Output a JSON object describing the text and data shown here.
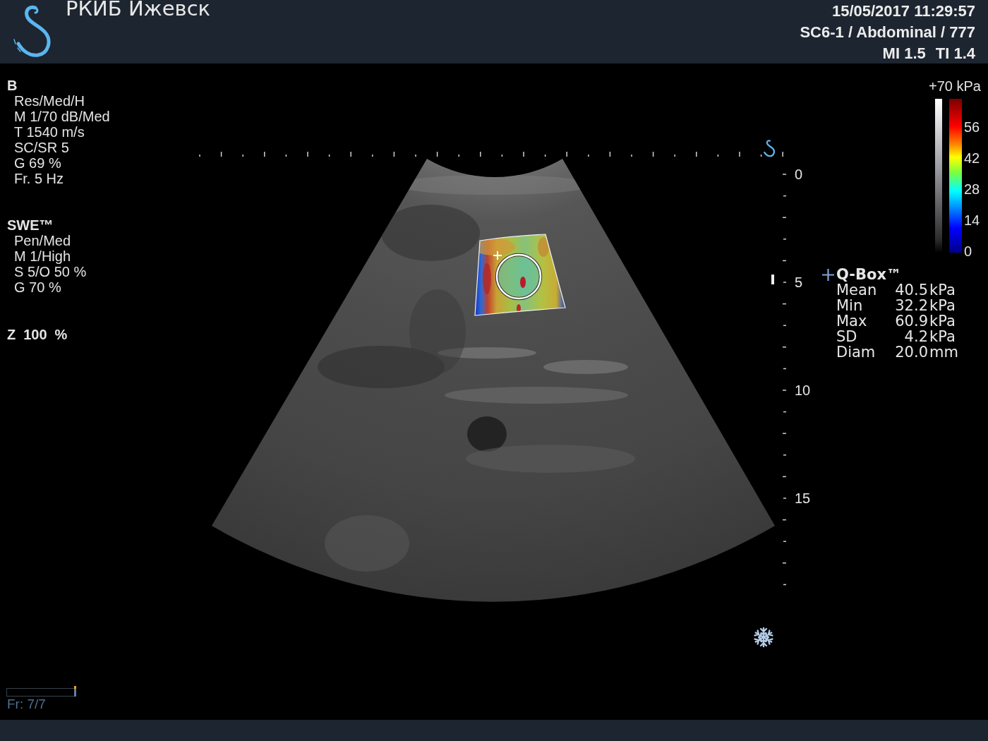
{
  "header": {
    "title": "РКИБ Ижевск",
    "datetime": "15/05/2017 11:29:57",
    "preset": "SC6-1 / Abdominal / 777",
    "indices": [
      "MI 1.5",
      "TI 1.4"
    ]
  },
  "parameters": [
    {
      "heading": "B",
      "lines": [
        "Res/Med/H",
        "M 1/70 dB/Med",
        "T 1540 m/s",
        "SC/SR 5",
        "G 69 %",
        "Fr. 5 Hz"
      ]
    },
    {
      "heading": "SWE™",
      "lines": [
        "Pen/Med",
        "M 1/High",
        "S 5/O 50 %",
        "G 70 %"
      ]
    }
  ],
  "zoom": {
    "label": "Z",
    "value": "100",
    "unit": "%"
  },
  "image": {
    "depth_labels": [
      "0",
      "5",
      "10",
      "15"
    ],
    "frozen": true
  },
  "color_scale": {
    "max_label": "+70 kPa",
    "labels": [
      "56",
      "42",
      "28",
      "14",
      "0"
    ]
  },
  "q_box": {
    "title": "Q-Box™",
    "rows": [
      {
        "label": "Mean",
        "value": "40.5",
        "unit": "kPa"
      },
      {
        "label": "Min",
        "value": "32.2",
        "unit": "kPa"
      },
      {
        "label": "Max",
        "value": "60.9",
        "unit": "kPa"
      },
      {
        "label": "SD",
        "value": "4.2",
        "unit": "kPa"
      },
      {
        "label": "Diam",
        "value": "20.0",
        "unit": "mm"
      }
    ]
  },
  "cine": {
    "level": 1,
    "frame_label": "Fr: 7/7"
  }
}
